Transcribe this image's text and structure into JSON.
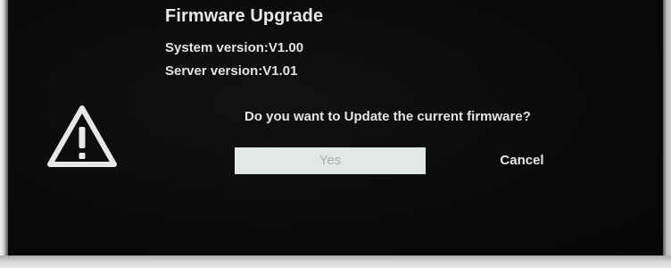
{
  "dialog": {
    "title": "Firmware Upgrade",
    "system_version": "System version:V1.00",
    "server_version": "Server version:V1.01",
    "question": "Do you want to Update the current firmware?",
    "icon": "warning-icon",
    "buttons": {
      "yes_label": "Yes",
      "cancel_label": "Cancel"
    },
    "colors": {
      "background": "#0a0a0a",
      "text": "#e6e6e6",
      "selected_button_bg": "#dfe8e4",
      "selected_button_text": "#a9b2ae"
    }
  }
}
